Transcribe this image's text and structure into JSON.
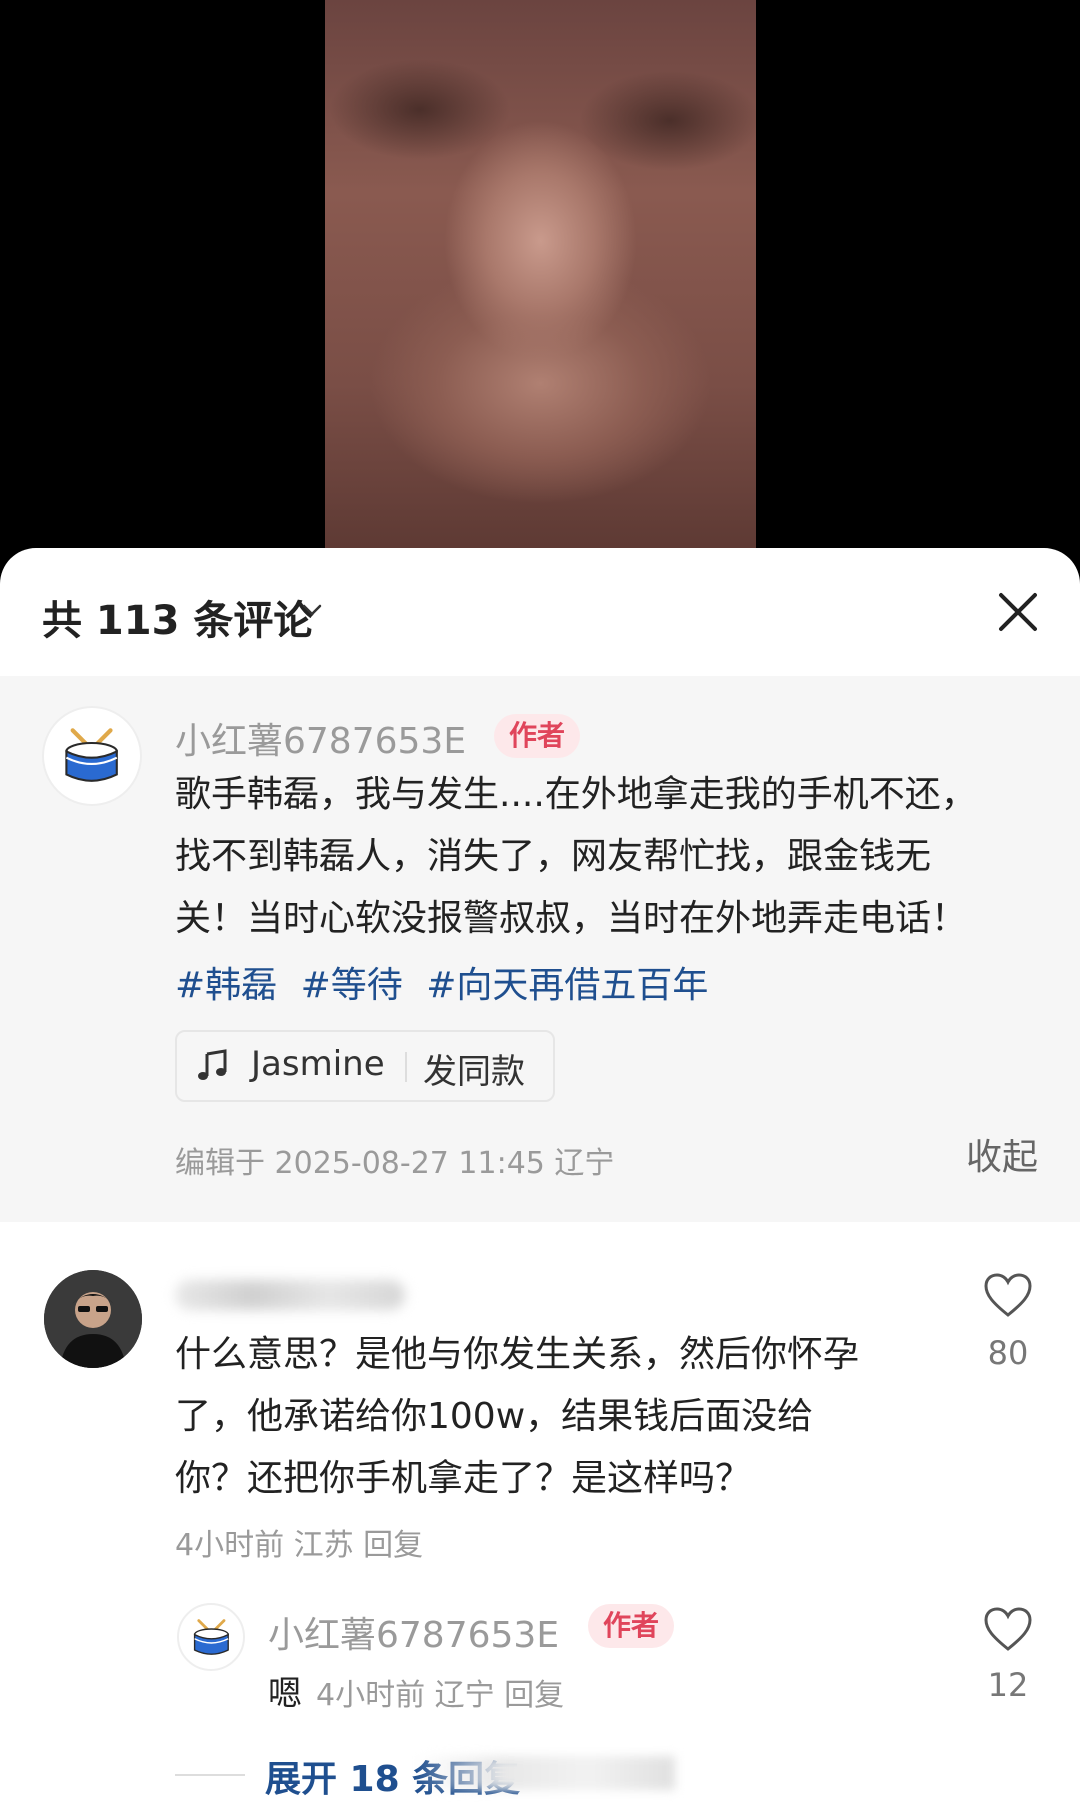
{
  "header": {
    "comment_count": "共 113 条评论"
  },
  "pinned_comment": {
    "username": "小红薯6787653E",
    "author_tag": "作者",
    "lines": [
      "歌手韩磊，我与发生....在外地拿走我的手机不还，",
      "找不到韩磊人，消失了，网友帮忙找，跟金钱无",
      "关！当时心软没报警叔叔，当时在外地弄走电话！"
    ],
    "hashtags": [
      "#韩磊",
      "#等待",
      "#向天再借五百年"
    ],
    "music": {
      "name": "Jasmine",
      "action": "发同款"
    },
    "edited": "编辑于 2025-08-27 11:45 辽宁",
    "collapse_label": "收起"
  },
  "comment": {
    "lines": [
      "什么意思？是他与你发生关系，然后你怀孕",
      "了，他承诺给你100w，结果钱后面没给",
      "你？还把你手机拿走了？是这样吗？"
    ],
    "meta": "4小时前 江苏 回复",
    "likes": "80"
  },
  "reply": {
    "username": "小红薯6787653E",
    "author_tag": "作者",
    "text": "嗯",
    "meta": "4小时前 辽宁 回复",
    "likes": "12"
  },
  "expand_replies": "展开 18 条回复",
  "colors": {
    "accent_link": "#1f4f8f",
    "author_tag_text": "#e0455b",
    "author_tag_bg": "#fde8ea"
  }
}
